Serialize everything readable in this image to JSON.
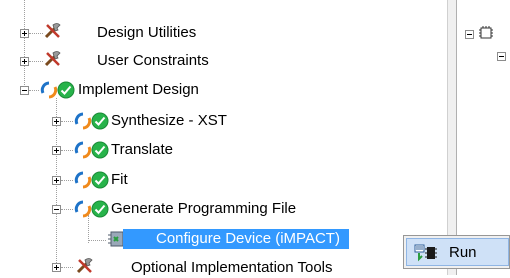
{
  "tree": {
    "items": [
      {
        "label": "Design Utilities",
        "icon": "tools-icon"
      },
      {
        "label": "User Constraints",
        "icon": "tools-icon"
      },
      {
        "label": "Implement Design",
        "icon": "refresh-check-icon"
      },
      {
        "label": "Synthesize - XST",
        "icon": "refresh-check-icon"
      },
      {
        "label": "Translate",
        "icon": "refresh-check-icon"
      },
      {
        "label": "Fit",
        "icon": "refresh-check-icon"
      },
      {
        "label": "Generate Programming File",
        "icon": "refresh-check-icon"
      },
      {
        "label": "Configure Device (iMPACT)",
        "icon": "impact-icon",
        "selected": true
      },
      {
        "label": "Optional Implementation Tools",
        "icon": "tools-icon"
      }
    ]
  },
  "context_menu": {
    "run_label": "Run",
    "run_icon": "run-icon"
  },
  "colors": {
    "selection": "#3399ff",
    "check_green": "#27b34a",
    "refresh_blue": "#1e73c8",
    "refresh_orange": "#f08a1c"
  }
}
